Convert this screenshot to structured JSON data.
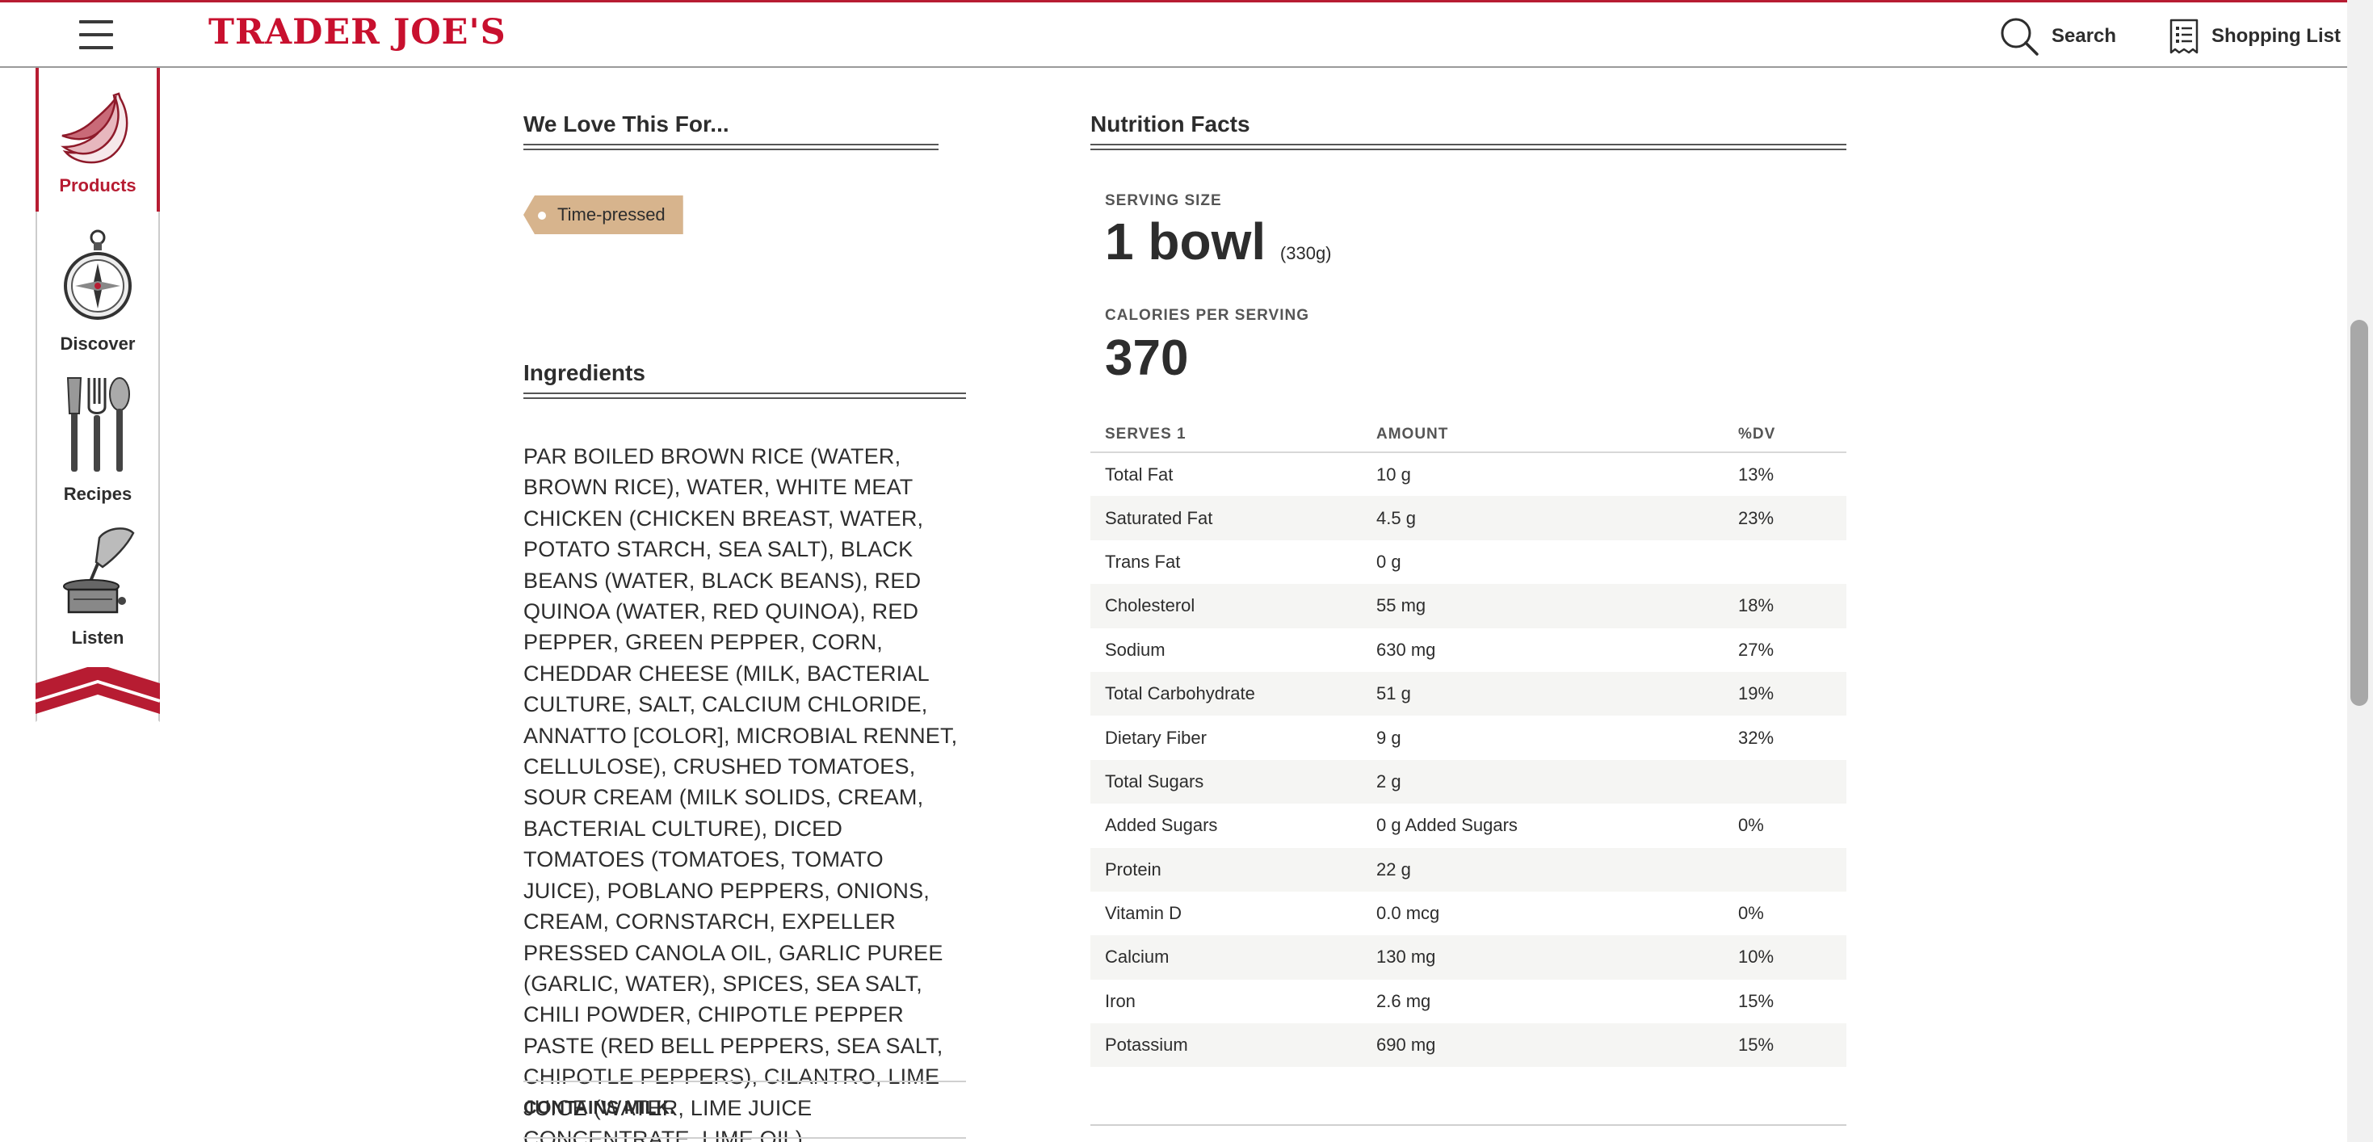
{
  "header": {
    "logo": "TRADER JOE'S",
    "search_label": "Search",
    "shopping_list_label": "Shopping List"
  },
  "nav": {
    "items": [
      {
        "label": "Products",
        "icon": "bananas-icon",
        "active": true
      },
      {
        "label": "Discover",
        "icon": "compass-icon",
        "active": false
      },
      {
        "label": "Recipes",
        "icon": "cutlery-icon",
        "active": false
      },
      {
        "label": "Listen",
        "icon": "gramophone-icon",
        "active": false
      }
    ]
  },
  "we_love": {
    "title": "We Love This For...",
    "tags": [
      "Time-pressed"
    ]
  },
  "ingredients": {
    "title": "Ingredients",
    "text": "PAR BOILED BROWN RICE (WATER, BROWN RICE), WATER, WHITE MEAT CHICKEN (CHICKEN BREAST, WATER, POTATO STARCH, SEA SALT), BLACK BEANS (WATER, BLACK BEANS), RED QUINOA (WATER, RED QUINOA), RED PEPPER, GREEN PEPPER, CORN, CHEDDAR CHEESE (MILK, BACTERIAL CULTURE, SALT, CALCIUM CHLORIDE, ANNATTO [COLOR], MICROBIAL RENNET, CELLULOSE), CRUSHED TOMATOES, SOUR CREAM (MILK SOLIDS, CREAM, BACTERIAL CULTURE), DICED TOMATOES (TOMATOES, TOMATO JUICE), POBLANO PEPPERS, ONIONS, CREAM, CORNSTARCH, EXPELLER PRESSED CANOLA OIL, GARLIC PUREE (GARLIC, WATER), SPICES, SEA SALT, CHILI POWDER, CHIPOTLE PEPPER PASTE (RED BELL PEPPERS, SEA SALT, CHIPOTLE PEPPERS), CILANTRO, LIME JUICE (WATER, LIME JUICE CONCENTRATE, LIME OIL).",
    "contains": "CONTAINS MILK."
  },
  "nutrition": {
    "title": "Nutrition Facts",
    "serving_size_label": "SERVING SIZE",
    "serving_size": "1 bowl",
    "serving_size_grams": "(330g)",
    "calories_label": "CALORIES PER SERVING",
    "calories": "370",
    "table_headers": [
      "SERVES 1",
      "AMOUNT",
      "%DV"
    ],
    "rows": [
      {
        "nutrient": "Total Fat",
        "amount": "10 g",
        "dv": "13%"
      },
      {
        "nutrient": "Saturated Fat",
        "amount": "4.5 g",
        "dv": "23%"
      },
      {
        "nutrient": "Trans Fat",
        "amount": "0 g",
        "dv": ""
      },
      {
        "nutrient": "Cholesterol",
        "amount": "55 mg",
        "dv": "18%"
      },
      {
        "nutrient": "Sodium",
        "amount": "630 mg",
        "dv": "27%"
      },
      {
        "nutrient": "Total Carbohydrate",
        "amount": "51 g",
        "dv": "19%"
      },
      {
        "nutrient": "Dietary Fiber",
        "amount": "9 g",
        "dv": "32%"
      },
      {
        "nutrient": "Total Sugars",
        "amount": "2 g",
        "dv": ""
      },
      {
        "nutrient": "Added Sugars",
        "amount": "0 g Added Sugars",
        "dv": "0%"
      },
      {
        "nutrient": "Protein",
        "amount": "22 g",
        "dv": ""
      },
      {
        "nutrient": "Vitamin D",
        "amount": "0.0 mcg",
        "dv": "0%"
      },
      {
        "nutrient": "Calcium",
        "amount": "130 mg",
        "dv": "10%"
      },
      {
        "nutrient": "Iron",
        "amount": "2.6 mg",
        "dv": "15%"
      },
      {
        "nutrient": "Potassium",
        "amount": "690 mg",
        "dv": "15%"
      }
    ]
  },
  "colors": {
    "brand_red": "#c8102e",
    "tag_tan": "#d7b48d",
    "row_alt": "#f5f5f3"
  }
}
